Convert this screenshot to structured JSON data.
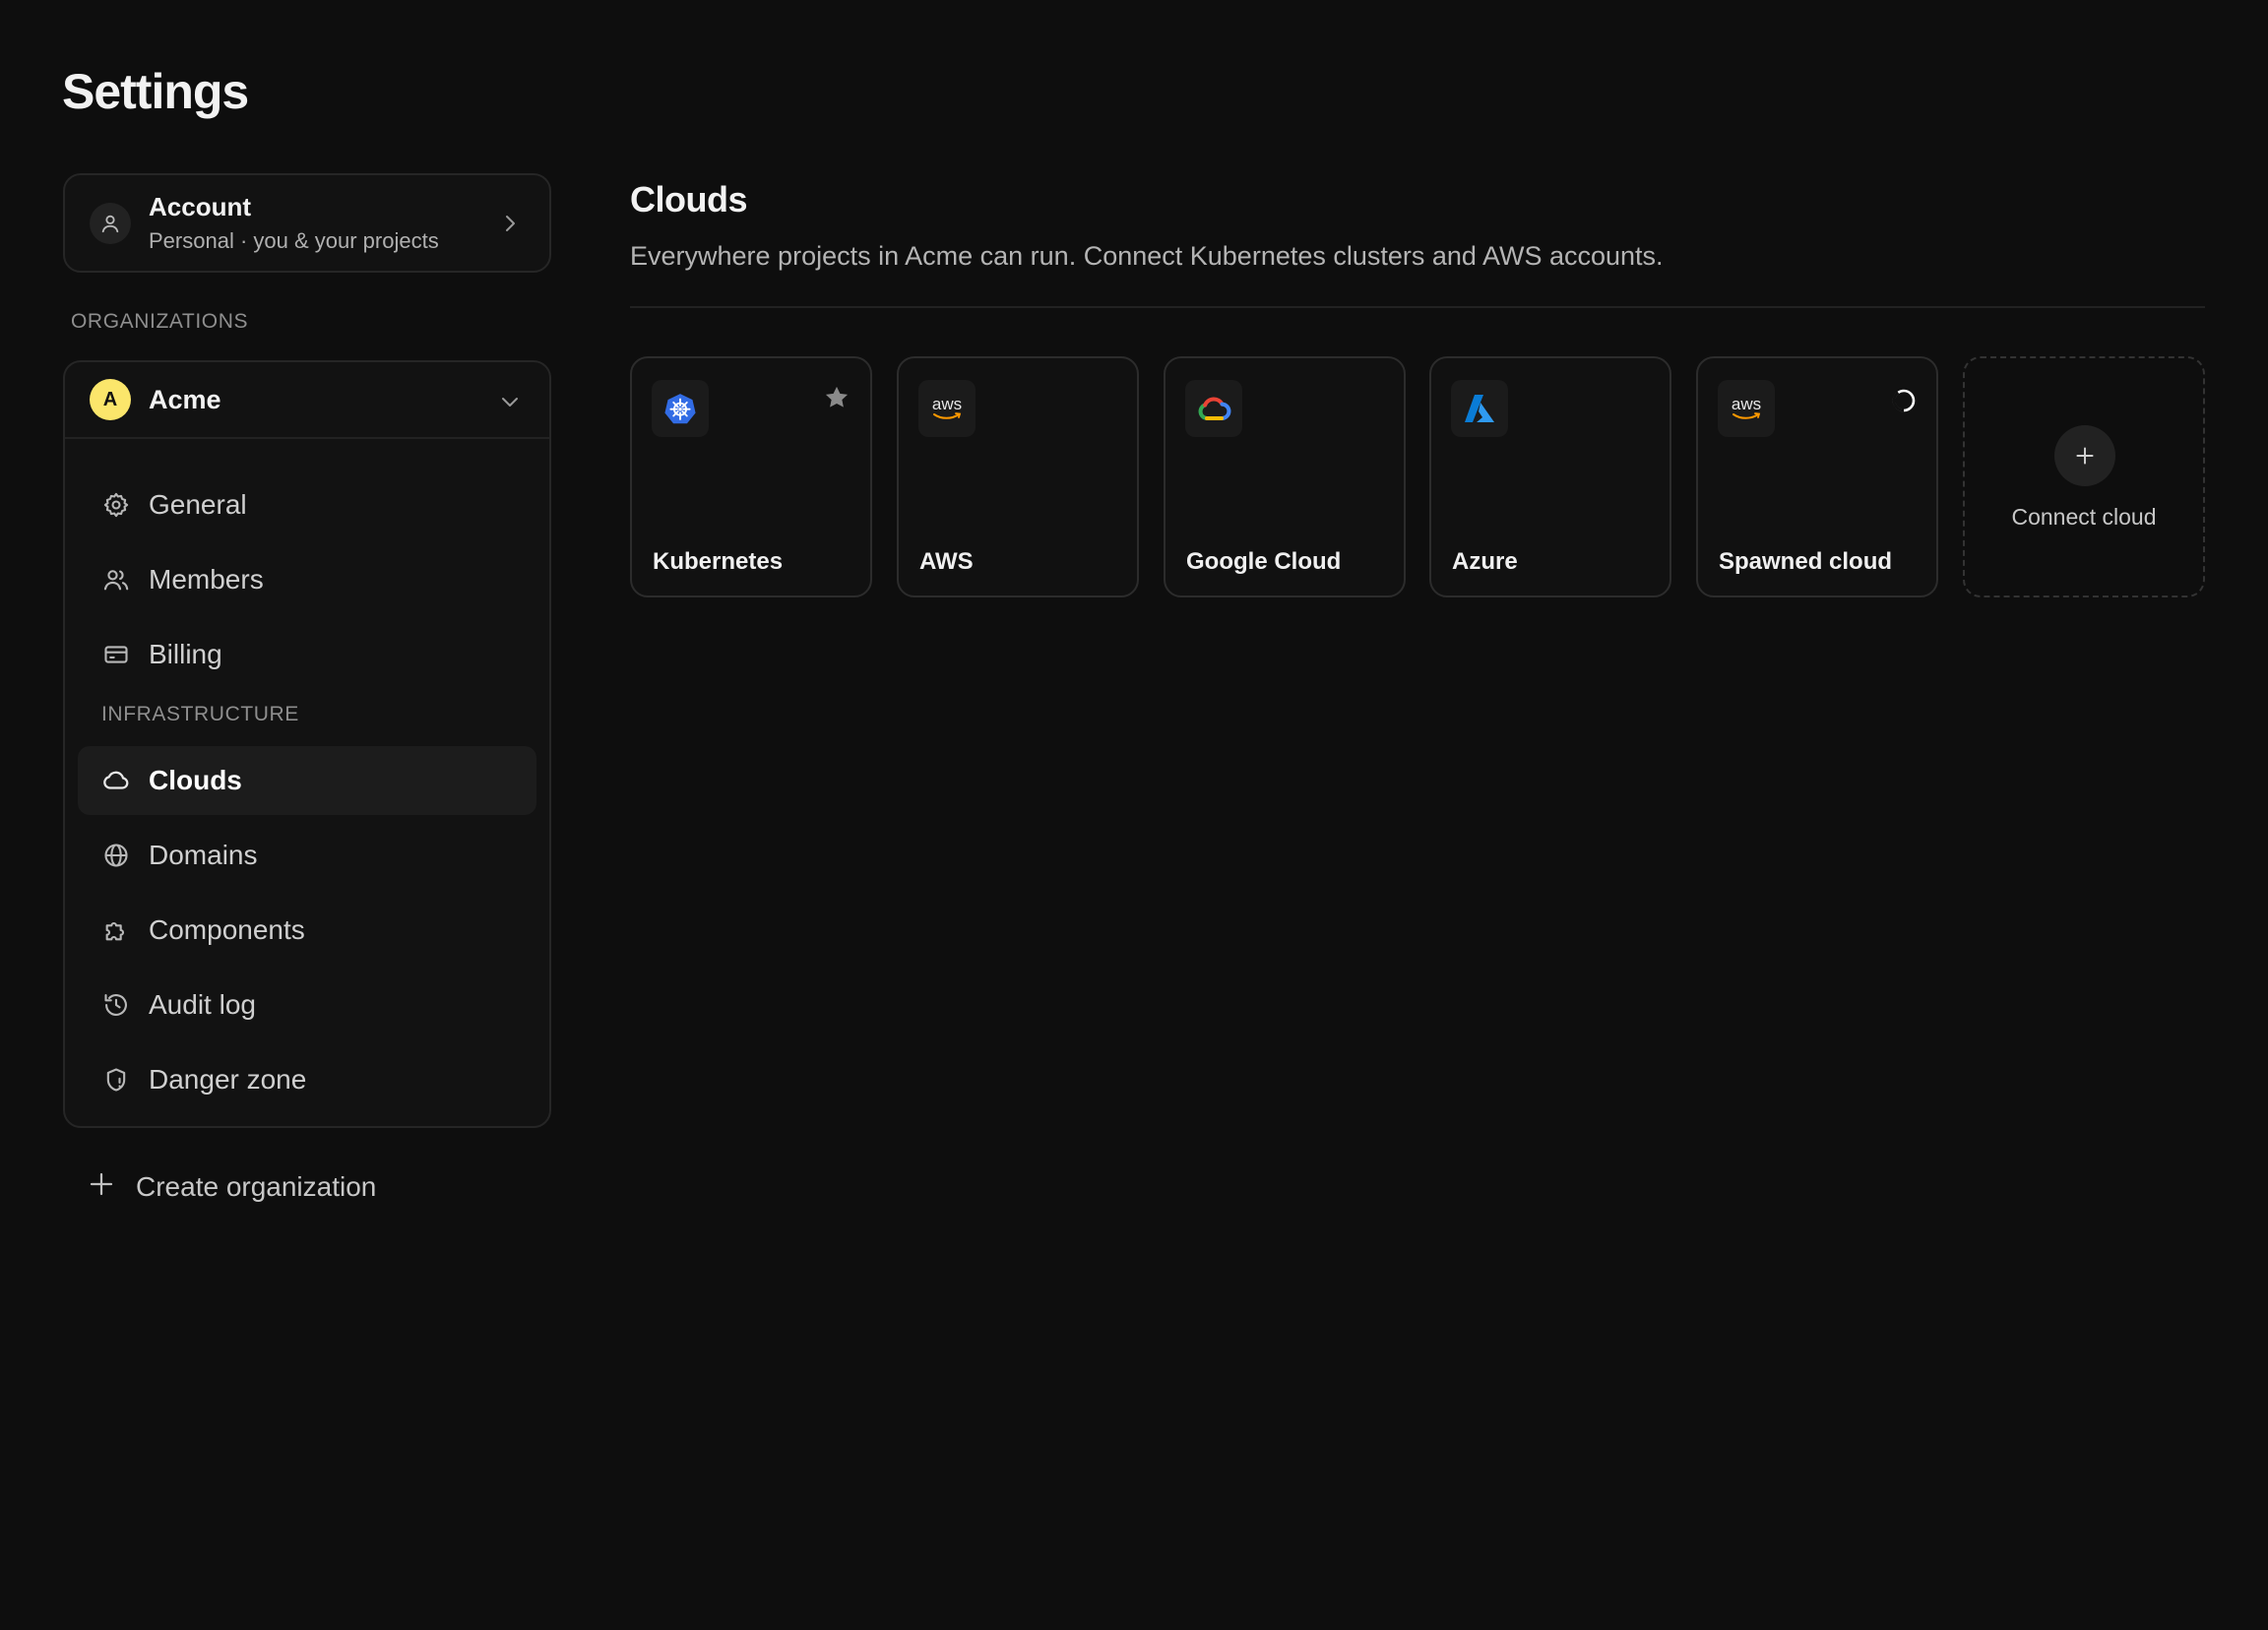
{
  "page": {
    "title": "Settings"
  },
  "account": {
    "title": "Account",
    "subtitle": "Personal · you & your projects",
    "icon": "user-icon"
  },
  "organizations_label": "ORGANIZATIONS",
  "org": {
    "avatar_letter": "A",
    "name": "Acme",
    "avatar_color": "#fbe66b",
    "nav": [
      {
        "label": "General",
        "icon": "gear-icon"
      },
      {
        "label": "Members",
        "icon": "users-icon"
      },
      {
        "label": "Billing",
        "icon": "credit-card-icon"
      }
    ],
    "infrastructure_label": "INFRASTRUCTURE",
    "infra_nav": [
      {
        "label": "Clouds",
        "icon": "cloud-icon",
        "active": true
      },
      {
        "label": "Domains",
        "icon": "globe-icon"
      },
      {
        "label": "Components",
        "icon": "puzzle-icon"
      },
      {
        "label": "Audit log",
        "icon": "history-icon"
      },
      {
        "label": "Danger zone",
        "icon": "shield-alert-icon"
      }
    ]
  },
  "create_org": {
    "label": "Create organization"
  },
  "main": {
    "title": "Clouds",
    "description": "Everywhere projects in Acme can run. Connect Kubernetes clusters and AWS accounts.",
    "clouds": [
      {
        "name": "Kubernetes",
        "icon": "kubernetes-logo",
        "badge": "star-icon"
      },
      {
        "name": "AWS",
        "icon": "aws-logo",
        "logo_text": "aws"
      },
      {
        "name": "Google Cloud",
        "icon": "google-cloud-logo"
      },
      {
        "name": "Azure",
        "icon": "azure-logo"
      },
      {
        "name": "Spawned cloud",
        "icon": "aws-logo",
        "logo_text": "aws",
        "badge": "loading-spinner-icon"
      }
    ],
    "connect_label": "Connect cloud"
  },
  "colors": {
    "background": "#0e0e0e",
    "card": "#121212",
    "border": "#262626",
    "kubernetes_blue": "#326ce5",
    "azure_blue": "#0a7cd6",
    "aws_orange": "#ff9900"
  }
}
